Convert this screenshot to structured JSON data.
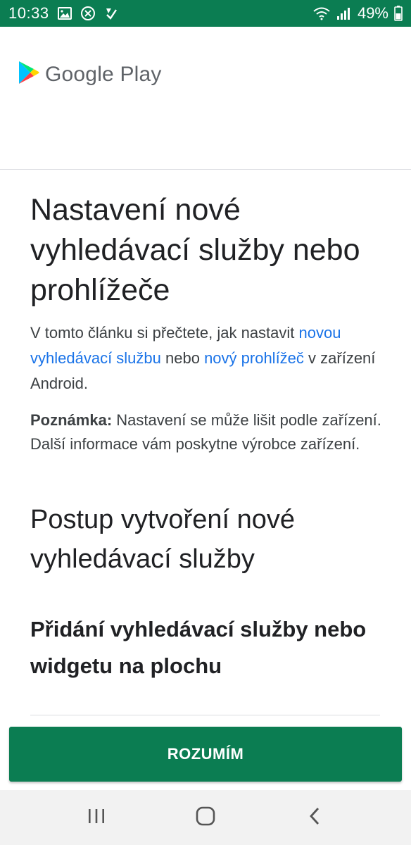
{
  "status_bar": {
    "time": "10:33",
    "battery": "49%",
    "icons": [
      "gallery-icon",
      "blocked-icon",
      "download-check-icon",
      "wifi-icon",
      "signal-icon"
    ]
  },
  "header": {
    "logo_text": "Google Play",
    "logo_icon": "play-store-triangle-icon"
  },
  "article": {
    "title": "Nastavení nové vyhledávací služby nebo prohlížeče",
    "intro_part1": "V tomto článku si přečtete, jak nastavit ",
    "intro_link1": "novou vyhledávací službu",
    "intro_part2": " nebo ",
    "intro_link2": "nový prohlížeč",
    "intro_part3": " v zařízení Android.",
    "note_label": "Poznámka:",
    "note_text": " Nastavení se může lišit podle zařízení. Další informace vám poskytne výrobce zařízení.",
    "section_title": "Postup vytvoření nové vyhledávací služby",
    "subsection_title": "Přidání vyhledávací služby nebo widgetu na plochu"
  },
  "button": {
    "label": "ROZUMÍM"
  },
  "nav": {
    "recents_icon": "recents-icon",
    "home_icon": "home-icon",
    "back_icon": "back-icon"
  },
  "colors": {
    "accent": "#0b7d52",
    "link": "#1a73e8",
    "text": "#202124"
  }
}
